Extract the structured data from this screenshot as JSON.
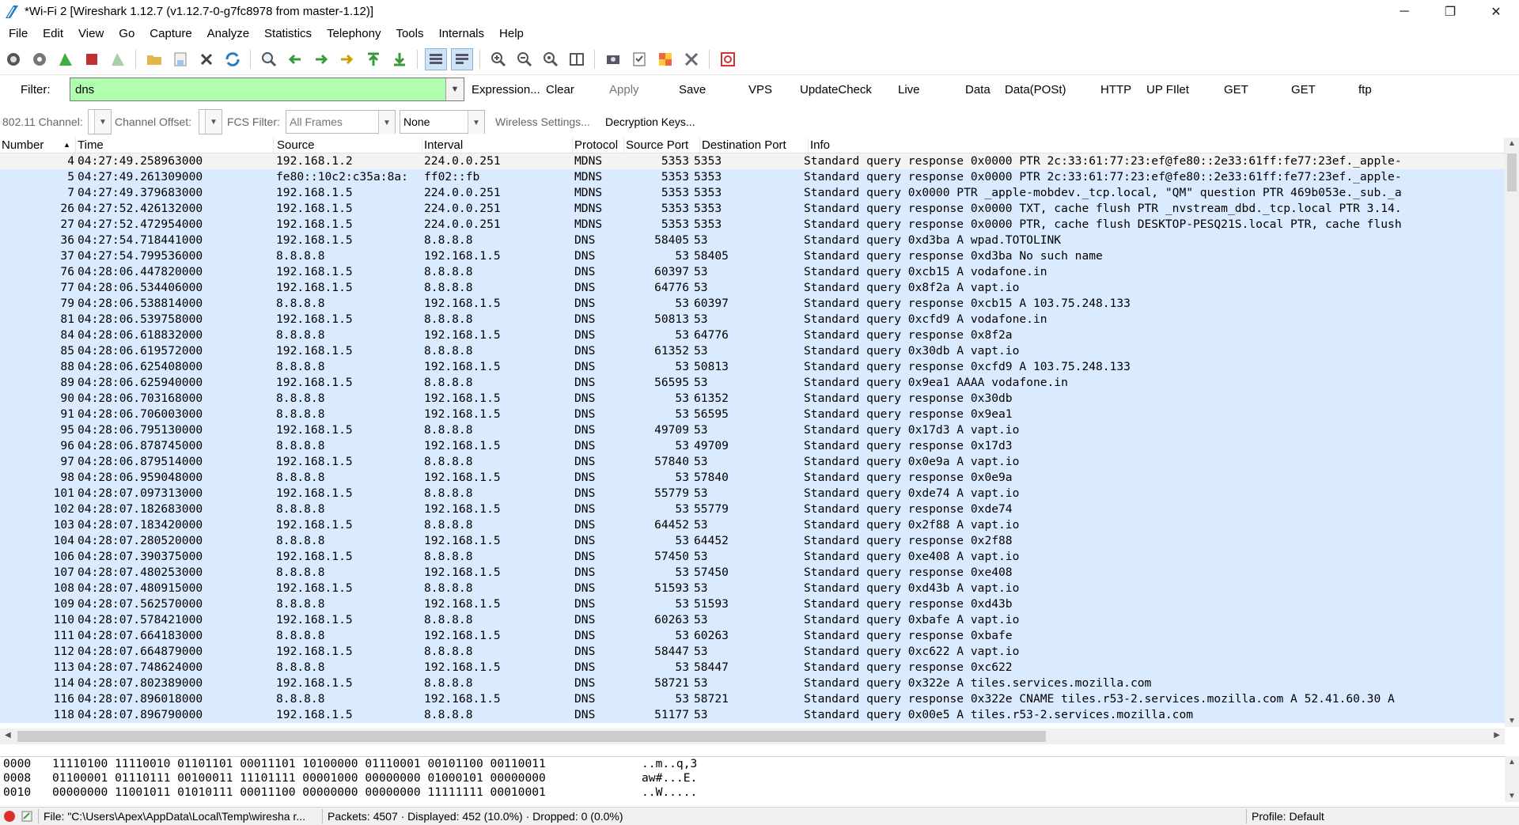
{
  "window": {
    "title": "*Wi-Fi 2  [Wireshark 1.12.7  (v1.12.7-0-g7fc8978 from master-1.12)]",
    "minimize": "─",
    "restore": "❐",
    "close": "✕"
  },
  "menu": [
    "File",
    "Edit",
    "View",
    "Go",
    "Capture",
    "Analyze",
    "Statistics",
    "Telephony",
    "Tools",
    "Internals",
    "Help"
  ],
  "filter": {
    "label": "Filter:",
    "value": "dns",
    "expression": "Expression...",
    "clear": "Clear",
    "apply": "Apply",
    "save": "Save",
    "buttons": [
      "VPS",
      "UpdateCheck",
      "Live",
      "Data",
      "Data(POSt)",
      "HTTP",
      "UP FIlet",
      "GET",
      "GET",
      "ftp"
    ]
  },
  "wireless": {
    "channel_label": "802.11 Channel:",
    "offset_label": "Channel Offset:",
    "fcs_label": "FCS Filter:",
    "fcs_value": "All Frames",
    "decrypt_mode": "None",
    "settings": "Wireless Settings...",
    "keys": "Decryption Keys..."
  },
  "packet_list": {
    "columns": [
      "Number",
      "Time",
      "Source",
      "Interval",
      "Protocol",
      "Source Port",
      "Destination Port",
      "Info"
    ],
    "sorted_column": "Number",
    "rows": [
      [
        "4",
        "04:27:49.258963000",
        "192.168.1.2",
        "224.0.0.251",
        "MDNS",
        "5353",
        "5353",
        "Standard query response 0x0000  PTR 2c:33:61:77:23:ef@fe80::2e33:61ff:fe77:23ef._apple-"
      ],
      [
        "5",
        "04:27:49.261309000",
        "fe80::10c2:c35a:8a:",
        "ff02::fb",
        "MDNS",
        "5353",
        "5353",
        "Standard query response 0x0000  PTR 2c:33:61:77:23:ef@fe80::2e33:61ff:fe77:23ef._apple-"
      ],
      [
        "7",
        "04:27:49.379683000",
        "192.168.1.5",
        "224.0.0.251",
        "MDNS",
        "5353",
        "5353",
        "Standard query 0x0000  PTR _apple-mobdev._tcp.local, \"QM\" question PTR 469b053e._sub._a"
      ],
      [
        "26",
        "04:27:52.426132000",
        "192.168.1.5",
        "224.0.0.251",
        "MDNS",
        "5353",
        "5353",
        "Standard query response 0x0000  TXT, cache flush PTR _nvstream_dbd._tcp.local PTR 3.14."
      ],
      [
        "27",
        "04:27:52.472954000",
        "192.168.1.5",
        "224.0.0.251",
        "MDNS",
        "5353",
        "5353",
        "Standard query response 0x0000  PTR, cache flush DESKTOP-PESQ21S.local PTR, cache flush"
      ],
      [
        "36",
        "04:27:54.718441000",
        "192.168.1.5",
        "8.8.8.8",
        "DNS",
        "58405",
        "53",
        "Standard query 0xd3ba  A wpad.TOTOLINK"
      ],
      [
        "37",
        "04:27:54.799536000",
        "8.8.8.8",
        "192.168.1.5",
        "DNS",
        "53",
        "58405",
        "Standard query response 0xd3ba No such name"
      ],
      [
        "76",
        "04:28:06.447820000",
        "192.168.1.5",
        "8.8.8.8",
        "DNS",
        "60397",
        "53",
        "Standard query 0xcb15  A vodafone.in"
      ],
      [
        "77",
        "04:28:06.534406000",
        "192.168.1.5",
        "8.8.8.8",
        "DNS",
        "64776",
        "53",
        "Standard query 0x8f2a  A vapt.io"
      ],
      [
        "79",
        "04:28:06.538814000",
        "8.8.8.8",
        "192.168.1.5",
        "DNS",
        "53",
        "60397",
        "Standard query response 0xcb15  A 103.75.248.133"
      ],
      [
        "81",
        "04:28:06.539758000",
        "192.168.1.5",
        "8.8.8.8",
        "DNS",
        "50813",
        "53",
        "Standard query 0xcfd9  A vodafone.in"
      ],
      [
        "84",
        "04:28:06.618832000",
        "8.8.8.8",
        "192.168.1.5",
        "DNS",
        "53",
        "64776",
        "Standard query response 0x8f2a"
      ],
      [
        "85",
        "04:28:06.619572000",
        "192.168.1.5",
        "8.8.8.8",
        "DNS",
        "61352",
        "53",
        "Standard query 0x30db  A vapt.io"
      ],
      [
        "88",
        "04:28:06.625408000",
        "8.8.8.8",
        "192.168.1.5",
        "DNS",
        "53",
        "50813",
        "Standard query response 0xcfd9  A 103.75.248.133"
      ],
      [
        "89",
        "04:28:06.625940000",
        "192.168.1.5",
        "8.8.8.8",
        "DNS",
        "56595",
        "53",
        "Standard query 0x9ea1  AAAA vodafone.in"
      ],
      [
        "90",
        "04:28:06.703168000",
        "8.8.8.8",
        "192.168.1.5",
        "DNS",
        "53",
        "61352",
        "Standard query response 0x30db"
      ],
      [
        "91",
        "04:28:06.706003000",
        "8.8.8.8",
        "192.168.1.5",
        "DNS",
        "53",
        "56595",
        "Standard query response 0x9ea1"
      ],
      [
        "95",
        "04:28:06.795130000",
        "192.168.1.5",
        "8.8.8.8",
        "DNS",
        "49709",
        "53",
        "Standard query 0x17d3  A vapt.io"
      ],
      [
        "96",
        "04:28:06.878745000",
        "8.8.8.8",
        "192.168.1.5",
        "DNS",
        "53",
        "49709",
        "Standard query response 0x17d3"
      ],
      [
        "97",
        "04:28:06.879514000",
        "192.168.1.5",
        "8.8.8.8",
        "DNS",
        "57840",
        "53",
        "Standard query 0x0e9a  A vapt.io"
      ],
      [
        "98",
        "04:28:06.959048000",
        "8.8.8.8",
        "192.168.1.5",
        "DNS",
        "53",
        "57840",
        "Standard query response 0x0e9a"
      ],
      [
        "101",
        "04:28:07.097313000",
        "192.168.1.5",
        "8.8.8.8",
        "DNS",
        "55779",
        "53",
        "Standard query 0xde74  A vapt.io"
      ],
      [
        "102",
        "04:28:07.182683000",
        "8.8.8.8",
        "192.168.1.5",
        "DNS",
        "53",
        "55779",
        "Standard query response 0xde74"
      ],
      [
        "103",
        "04:28:07.183420000",
        "192.168.1.5",
        "8.8.8.8",
        "DNS",
        "64452",
        "53",
        "Standard query 0x2f88  A vapt.io"
      ],
      [
        "104",
        "04:28:07.280520000",
        "8.8.8.8",
        "192.168.1.5",
        "DNS",
        "53",
        "64452",
        "Standard query response 0x2f88"
      ],
      [
        "106",
        "04:28:07.390375000",
        "192.168.1.5",
        "8.8.8.8",
        "DNS",
        "57450",
        "53",
        "Standard query 0xe408  A vapt.io"
      ],
      [
        "107",
        "04:28:07.480253000",
        "8.8.8.8",
        "192.168.1.5",
        "DNS",
        "53",
        "57450",
        "Standard query response 0xe408"
      ],
      [
        "108",
        "04:28:07.480915000",
        "192.168.1.5",
        "8.8.8.8",
        "DNS",
        "51593",
        "53",
        "Standard query 0xd43b  A vapt.io"
      ],
      [
        "109",
        "04:28:07.562570000",
        "8.8.8.8",
        "192.168.1.5",
        "DNS",
        "53",
        "51593",
        "Standard query response 0xd43b"
      ],
      [
        "110",
        "04:28:07.578421000",
        "192.168.1.5",
        "8.8.8.8",
        "DNS",
        "60263",
        "53",
        "Standard query 0xbafe  A vapt.io"
      ],
      [
        "111",
        "04:28:07.664183000",
        "8.8.8.8",
        "192.168.1.5",
        "DNS",
        "53",
        "60263",
        "Standard query response 0xbafe"
      ],
      [
        "112",
        "04:28:07.664879000",
        "192.168.1.5",
        "8.8.8.8",
        "DNS",
        "58447",
        "53",
        "Standard query 0xc622  A vapt.io"
      ],
      [
        "113",
        "04:28:07.748624000",
        "8.8.8.8",
        "192.168.1.5",
        "DNS",
        "53",
        "58447",
        "Standard query response 0xc622"
      ],
      [
        "114",
        "04:28:07.802389000",
        "192.168.1.5",
        "8.8.8.8",
        "DNS",
        "58721",
        "53",
        "Standard query 0x322e  A tiles.services.mozilla.com"
      ],
      [
        "116",
        "04:28:07.896018000",
        "8.8.8.8",
        "192.168.1.5",
        "DNS",
        "53",
        "58721",
        "Standard query response 0x322e  CNAME tiles.r53-2.services.mozilla.com A 52.41.60.30 A"
      ],
      [
        "118",
        "04:28:07.896790000",
        "192.168.1.5",
        "8.8.8.8",
        "DNS",
        "51177",
        "53",
        "Standard query 0x00e5  A tiles.r53-2.services.mozilla.com"
      ]
    ]
  },
  "bytes": [
    [
      "0000",
      "11110100 11110010 01101101 00011101 10100000 01110001 00101100 00110011",
      "..m..q,3"
    ],
    [
      "0008",
      "01100001 01110111 00100011 11101111 00001000 00000000 01000101 00000000",
      "aw#...E."
    ],
    [
      "0010",
      "00000000 11001011 01010111 00011100 00000000 00000000 11111111 00010001",
      "..W....."
    ]
  ],
  "status": {
    "file": "File: \"C:\\Users\\Apex\\AppData\\Local\\Temp\\wiresha r...",
    "packets": "Packets: 4507 · Displayed: 452 (10.0%) · Dropped: 0 (0.0%)",
    "profile": "Profile: Default"
  },
  "colors": {
    "row_bg": "#dbebff",
    "filter_ok": "#afffaf"
  }
}
